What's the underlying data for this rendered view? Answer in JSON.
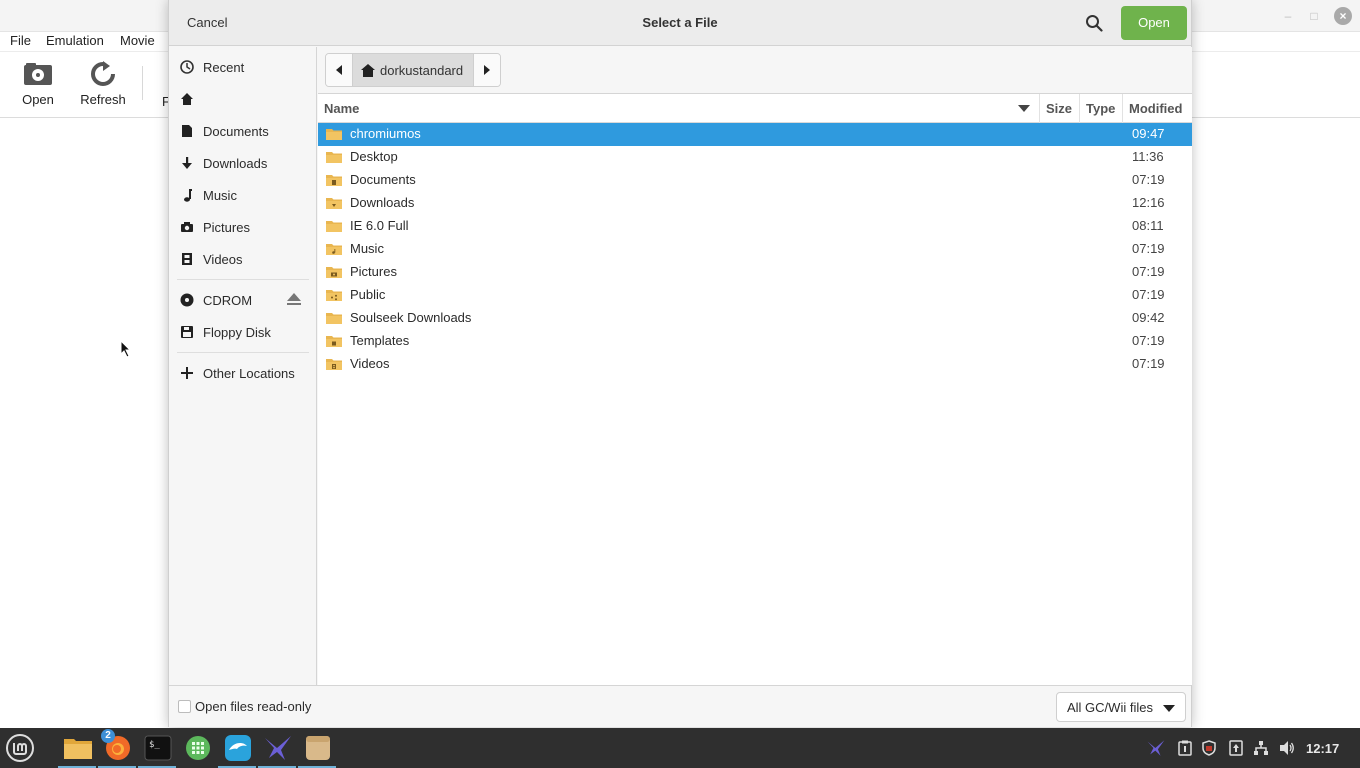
{
  "background_app": {
    "menu": [
      "File",
      "Emulation",
      "Movie"
    ],
    "toolbar": {
      "open_label": "Open",
      "refresh_label": "Refresh",
      "partial_label": "F"
    }
  },
  "dialog": {
    "title": "Select a File",
    "cancel_label": "Cancel",
    "open_label": "Open",
    "sidebar": {
      "recent": "Recent",
      "home": "",
      "documents": "Documents",
      "downloads": "Downloads",
      "music": "Music",
      "pictures": "Pictures",
      "videos": "Videos",
      "cdrom": "CDROM",
      "floppy": "Floppy Disk",
      "other": "Other Locations"
    },
    "pathbar": {
      "current": "dorkustandard"
    },
    "columns": {
      "name": "Name",
      "size": "Size",
      "type": "Type",
      "modified": "Modified"
    },
    "files": [
      {
        "name": "chromiumos",
        "modified": "09:47",
        "icon": "folder-icon"
      },
      {
        "name": "Desktop",
        "modified": "11:36",
        "icon": "folder-icon"
      },
      {
        "name": "Documents",
        "modified": "07:19",
        "icon": "folder-documents-icon"
      },
      {
        "name": "Downloads",
        "modified": "12:16",
        "icon": "folder-downloads-icon"
      },
      {
        "name": "IE 6.0 Full",
        "modified": "08:11",
        "icon": "folder-icon"
      },
      {
        "name": "Music",
        "modified": "07:19",
        "icon": "folder-music-icon"
      },
      {
        "name": "Pictures",
        "modified": "07:19",
        "icon": "folder-pictures-icon"
      },
      {
        "name": "Public",
        "modified": "07:19",
        "icon": "folder-public-icon"
      },
      {
        "name": "Soulseek Downloads",
        "modified": "09:42",
        "icon": "folder-icon"
      },
      {
        "name": "Templates",
        "modified": "07:19",
        "icon": "folder-templates-icon"
      },
      {
        "name": "Videos",
        "modified": "07:19",
        "icon": "folder-videos-icon"
      }
    ],
    "footer": {
      "readonly_label": "Open files read-only",
      "filter_label": "All GC/Wii files"
    }
  },
  "taskbar": {
    "clock": "12:17",
    "badge_count": "2"
  },
  "colors": {
    "accent": "#2f9ade",
    "open_button": "#6fb34c",
    "taskbar": "#2f2f2f",
    "folder": "#e9b650"
  }
}
